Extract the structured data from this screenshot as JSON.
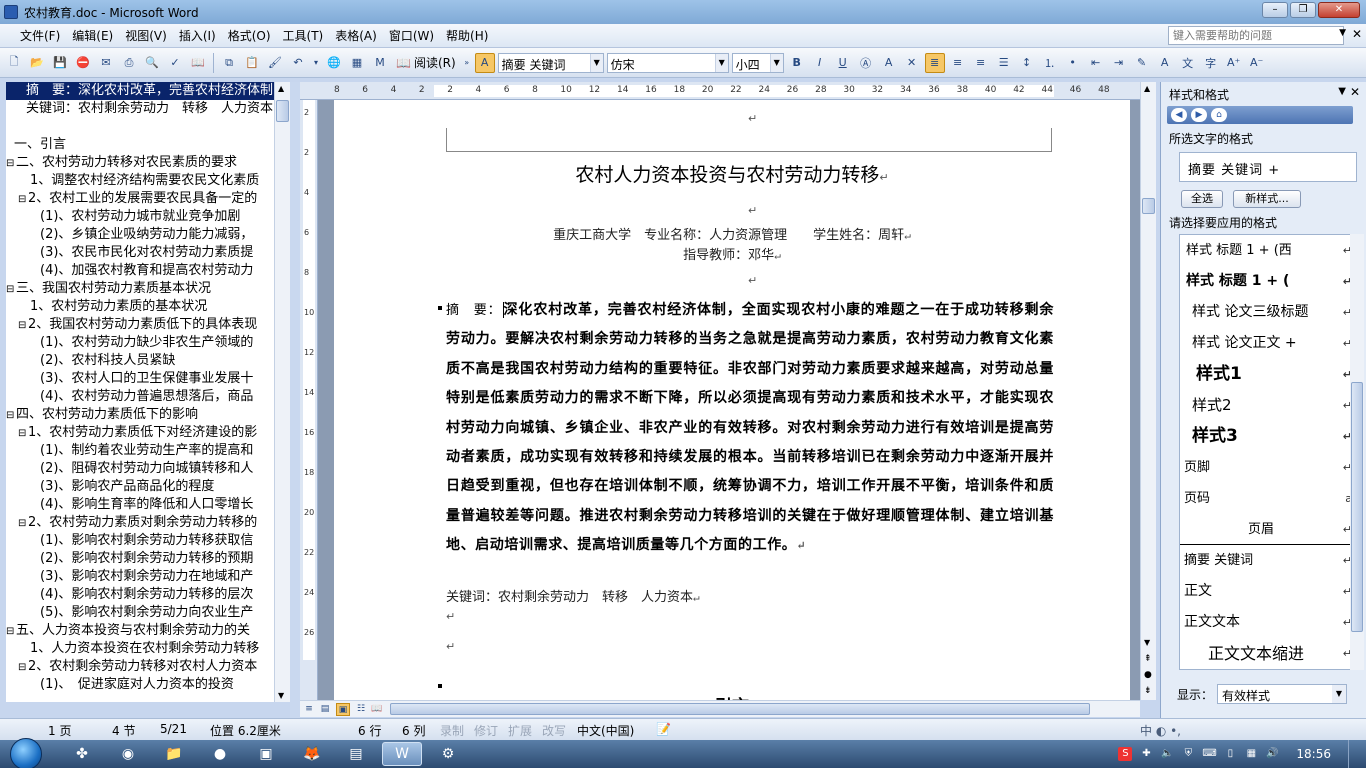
{
  "window": {
    "title": "农村教育.doc - Microsoft Word"
  },
  "menu": [
    "文件(F)",
    "编辑(E)",
    "视图(V)",
    "插入(I)",
    "格式(O)",
    "工具(T)",
    "表格(A)",
    "窗口(W)",
    "帮助(H)"
  ],
  "help_placeholder": "键入需要帮助的问题",
  "toolbar": {
    "read_label": "阅读(R)",
    "style_combo": "摘要 关键词",
    "font_combo": "仿宋",
    "size_combo": "小四",
    "bold": "B",
    "italic": "I",
    "underline": "U"
  },
  "ruler": {
    "h_numbers": [
      "8",
      "6",
      "4",
      "2",
      "2",
      "4",
      "6",
      "8",
      "10",
      "12",
      "14",
      "16",
      "18",
      "20",
      "22",
      "24",
      "26",
      "28",
      "30",
      "32",
      "34",
      "36",
      "38",
      "40",
      "42",
      "44",
      "46",
      "48"
    ],
    "v_numbers": [
      "2",
      "2",
      "4",
      "6",
      "8",
      "10",
      "12",
      "14",
      "16",
      "18",
      "20",
      "22",
      "24",
      "26"
    ]
  },
  "docmap": {
    "items": [
      {
        "text": "摘　要：深化农村改革，完善农村经济体制",
        "level": 0,
        "toggle": "",
        "selected": true
      },
      {
        "text": "关键词：农村剩余劳动力　转移　人力资本",
        "level": 0,
        "toggle": "",
        "selected": false
      },
      {
        "text": "",
        "level": 0,
        "toggle": "",
        "selected": false
      },
      {
        "text": "一、引言",
        "level": 1,
        "toggle": "",
        "selected": false
      },
      {
        "text": "二、农村劳动力转移对农民素质的要求",
        "level": 1,
        "toggle": "⊟",
        "selected": false
      },
      {
        "text": "1、调整农村经济结构需要农民文化素质",
        "level": 2,
        "toggle": "",
        "selected": false
      },
      {
        "text": "2、农村工业的发展需要农民具备一定的",
        "level": 2,
        "toggle": "⊟",
        "selected": false
      },
      {
        "text": "(1)、农村劳动力城市就业竞争加剧",
        "level": 3,
        "toggle": "",
        "selected": false
      },
      {
        "text": "(2)、乡镇企业吸纳劳动力能力减弱，",
        "level": 3,
        "toggle": "",
        "selected": false
      },
      {
        "text": "(3)、农民市民化对农村劳动力素质提",
        "level": 3,
        "toggle": "",
        "selected": false
      },
      {
        "text": "(4)、加强农村教育和提高农村劳动力",
        "level": 3,
        "toggle": "",
        "selected": false
      },
      {
        "text": "三、我国农村劳动力素质基本状况",
        "level": 1,
        "toggle": "⊟",
        "selected": false
      },
      {
        "text": "1、农村劳动力素质的基本状况",
        "level": 2,
        "toggle": "",
        "selected": false
      },
      {
        "text": "2、我国农村劳动力素质低下的具体表现",
        "level": 2,
        "toggle": "⊟",
        "selected": false
      },
      {
        "text": "(1)、农村劳动力缺少非农生产领域的",
        "level": 3,
        "toggle": "",
        "selected": false
      },
      {
        "text": "(2)、农村科技人员紧缺",
        "level": 3,
        "toggle": "",
        "selected": false
      },
      {
        "text": "(3)、农村人口的卫生保健事业发展十",
        "level": 3,
        "toggle": "",
        "selected": false
      },
      {
        "text": "(4)、农村劳动力普遍思想落后，商品",
        "level": 3,
        "toggle": "",
        "selected": false
      },
      {
        "text": "四、农村劳动力素质低下的影响",
        "level": 1,
        "toggle": "⊟",
        "selected": false
      },
      {
        "text": "1、农村劳动力素质低下对经济建设的影",
        "level": 2,
        "toggle": "⊟",
        "selected": false
      },
      {
        "text": "(1)、制约着农业劳动生产率的提高和",
        "level": 3,
        "toggle": "",
        "selected": false
      },
      {
        "text": "(2)、阻碍农村劳动力向城镇转移和人",
        "level": 3,
        "toggle": "",
        "selected": false
      },
      {
        "text": "(3)、影响农产品商品化的程度",
        "level": 3,
        "toggle": "",
        "selected": false
      },
      {
        "text": "(4)、影响生育率的降低和人口零增长",
        "level": 3,
        "toggle": "",
        "selected": false
      },
      {
        "text": "2、农村劳动力素质对剩余劳动力转移的",
        "level": 2,
        "toggle": "⊟",
        "selected": false
      },
      {
        "text": "(1)、影响农村剩余劳动力转移获取信",
        "level": 3,
        "toggle": "",
        "selected": false
      },
      {
        "text": "(2)、影响农村剩余劳动力转移的预期",
        "level": 3,
        "toggle": "",
        "selected": false
      },
      {
        "text": "(3)、影响农村剩余劳动力在地域和产",
        "level": 3,
        "toggle": "",
        "selected": false
      },
      {
        "text": "(4)、影响农村剩余劳动力转移的层次",
        "level": 3,
        "toggle": "",
        "selected": false
      },
      {
        "text": "(5)、影响农村剩余劳动力向农业生产",
        "level": 3,
        "toggle": "",
        "selected": false
      },
      {
        "text": "五、人力资本投资与农村剩余劳动力的关",
        "level": 1,
        "toggle": "⊟",
        "selected": false
      },
      {
        "text": "1、人力资本投资在农村剩余劳动力转移",
        "level": 2,
        "toggle": "",
        "selected": false
      },
      {
        "text": "2、农村剩余劳动力转移对农村人力资本",
        "level": 2,
        "toggle": "⊟",
        "selected": false
      },
      {
        "text": "(1)、　促进家庭对人力资本的投资",
        "level": 3,
        "toggle": "",
        "selected": false
      }
    ]
  },
  "document": {
    "title": "农村人力资本投资与农村劳动力转移",
    "author_line": "重庆工商大学　专业名称：人力资源管理　　学生姓名：周轩",
    "advisor_line": "指导教师：邓华",
    "abstract_label": "摘　要：",
    "abstract_body": "深化农村改革，完善农村经济体制，全面实现农村小康的难题之一在于成功转移剩余劳动力。要解决农村剩余劳动力转移的当务之急就是提高劳动力素质，农村劳动力教育文化素质不高是我国农村劳动力结构的重要特征。非农部门对劳动力素质要求越来越高，对劳动总量特别是低素质劳动力的需求不断下降，所以必须提高现有劳动力素质和技术水平，才能实现农村劳动力向城镇、乡镇企业、非农产业的有效转移。对农村剩余劳动力进行有效培训是提高劳动者素质，成功实现有效转移和持续发展的根本。当前转移培训已在剩余劳动力中逐渐开展并日趋受到重视，但也存在培训体制不顺，统筹协调不力，培训工作开展不平衡，培训条件和质量普遍较差等问题。推进农村剩余劳动力转移培训的关键在于做好理顺管理体制、建立培训基地、启动培训需求、提高培训质量等几个方面的工作。",
    "keywords": "关键词：农村剩余劳动力　转移　人力资本",
    "next_heading": "引言"
  },
  "taskpane": {
    "title": "样式和格式",
    "current_label": "所选文字的格式",
    "current_value": "摘要 关键词 +",
    "select_all": "全选",
    "new_style": "新样式...",
    "apply_label": "请选择要应用的格式",
    "styles": [
      {
        "name": "样式 标题 1 + (西",
        "mark": "↵"
      },
      {
        "name": "样式 标题 1 + (",
        "mark": "↵"
      },
      {
        "name": "样式 论文三级标题",
        "mark": "↵"
      },
      {
        "name": "样式 论文正文 +",
        "mark": "↵"
      },
      {
        "name": "样式1",
        "mark": "↵"
      },
      {
        "name": "样式2",
        "mark": "↵"
      },
      {
        "name": "样式3",
        "mark": "↵"
      },
      {
        "name": "页脚",
        "mark": "↵"
      },
      {
        "name": "页码",
        "mark": "a"
      },
      {
        "name": "页眉",
        "mark": "↵"
      },
      {
        "name": "摘要 关键词",
        "mark": "↵"
      },
      {
        "name": "正文",
        "mark": "↵"
      },
      {
        "name": "正文文本",
        "mark": "↵"
      },
      {
        "name": "正文文本缩进",
        "mark": "↵"
      }
    ],
    "show_label": "显示：",
    "show_value": "有效样式"
  },
  "status": {
    "page": "1 页",
    "section": "4 节",
    "pages": "5/21",
    "position": "位置 6.2厘米",
    "line": "6 行",
    "column": "6 列",
    "rec": "录制",
    "trk": "修订",
    "ext": "扩展",
    "ovr": "改写",
    "lang": "中文(中国)"
  },
  "taskbar": {
    "time": "18:56"
  }
}
